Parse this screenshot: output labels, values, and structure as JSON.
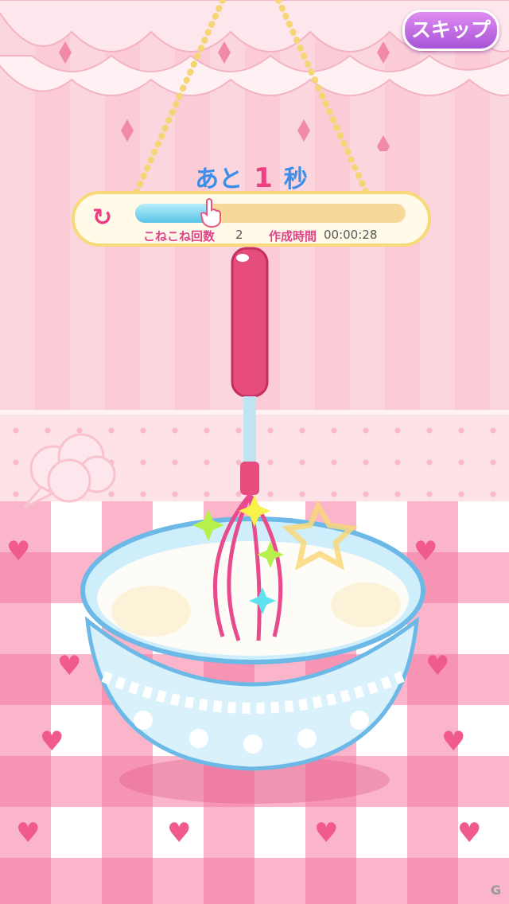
{
  "skip_button": {
    "label": "スキップ"
  },
  "timer": {
    "prefix": "あと",
    "value": "1",
    "suffix": "秒"
  },
  "stats": {
    "knead_label": "こねこね回数",
    "knead_count": "2",
    "time_label": "作成時間",
    "time_value": "00:00:28"
  },
  "progress": {
    "fraction": 0.28
  },
  "icons": {
    "undo": "swirl-arrow-icon",
    "pointer": "hand-pointer-icon"
  },
  "colors": {
    "accent_pink": "#ee3f84",
    "accent_blue": "#3c8ee8",
    "skip_purple": "#b25fdc"
  },
  "watermark": "G"
}
